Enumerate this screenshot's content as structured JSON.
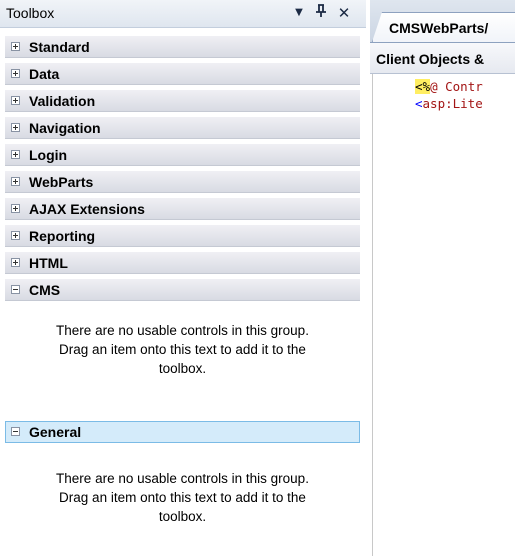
{
  "toolbox": {
    "title": "Toolbox",
    "buttons": {
      "dropdown": "▼",
      "pin": "ᴨ",
      "close": "✕"
    },
    "groups": [
      {
        "label": "Standard",
        "expanded": false
      },
      {
        "label": "Data",
        "expanded": false
      },
      {
        "label": "Validation",
        "expanded": false
      },
      {
        "label": "Navigation",
        "expanded": false
      },
      {
        "label": "Login",
        "expanded": false
      },
      {
        "label": "WebParts",
        "expanded": false
      },
      {
        "label": "AJAX Extensions",
        "expanded": false
      },
      {
        "label": "Reporting",
        "expanded": false
      },
      {
        "label": "HTML",
        "expanded": false
      },
      {
        "label": "CMS",
        "expanded": true
      },
      {
        "label": "General",
        "expanded": true,
        "selected": true
      }
    ],
    "empty_message": "There are no usable controls in this group. Drag an item onto this text to add it to the toolbox.",
    "empty_lines": [
      "There are no usable controls in this group.",
      "Drag an item onto this text to add it to the",
      "toolbox."
    ]
  },
  "editor": {
    "tab_label": "CMSWebParts/",
    "nav_label": "Client Objects &",
    "code": [
      {
        "hl": "<%",
        "rest": "@ Contr"
      },
      {
        "tag_open": "<",
        "element": "asp:Lite"
      }
    ]
  },
  "colors": {
    "selected_group_bg": "#d4ebfa",
    "selected_group_border": "#7bbbe6",
    "directive_highlight": "#ffee62",
    "code_tag": "#0000ff",
    "code_element": "#a31515"
  }
}
